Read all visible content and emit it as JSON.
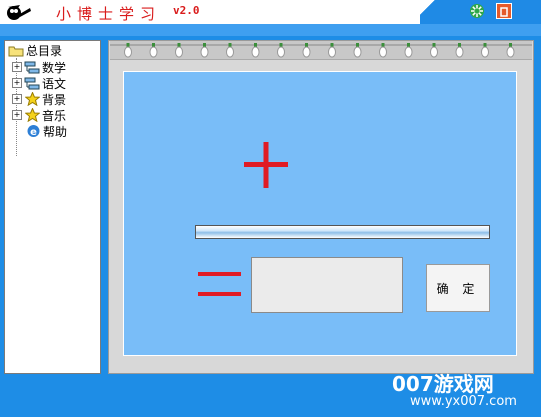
{
  "window": {
    "title": "小博士学习",
    "version": "v2.0",
    "logo_icon": "mascot-icon",
    "buttons": [
      {
        "icon": "settings-icon"
      },
      {
        "icon": "close-icon"
      }
    ]
  },
  "tree": {
    "root": {
      "label": "总目录",
      "icon": "folder-icon"
    },
    "items": [
      {
        "label": "数学",
        "icon": "network-icon",
        "expander": "+"
      },
      {
        "label": "语文",
        "icon": "network-icon",
        "expander": "+"
      },
      {
        "label": "背景",
        "icon": "star-icon",
        "expander": "+"
      },
      {
        "label": "音乐",
        "icon": "star-icon",
        "expander": "+"
      },
      {
        "label": "帮助",
        "icon": "ie-icon"
      }
    ]
  },
  "exercise": {
    "operator": "+",
    "equals": "=",
    "answer_value": "",
    "confirm_label": "确 定"
  },
  "watermark": {
    "text": "007游戏网",
    "url": "www.yx007.com"
  },
  "colors": {
    "app_blue": "#1e8de6",
    "work_area": "#79bdf8",
    "symbol_red": "#e01b24"
  }
}
